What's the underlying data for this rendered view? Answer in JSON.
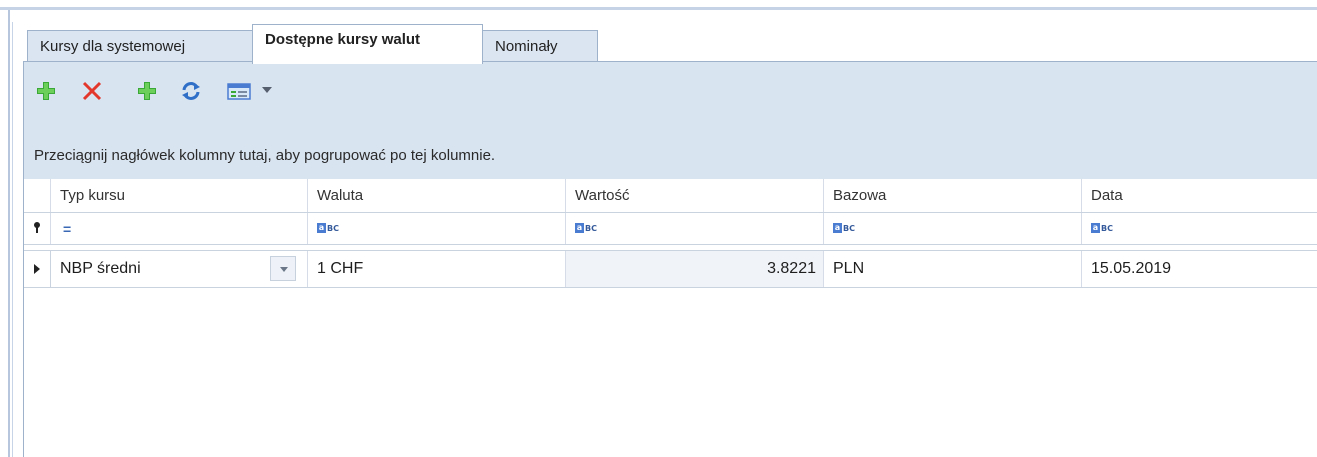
{
  "tabs": [
    {
      "label": "Kursy dla systemowej",
      "active": false
    },
    {
      "label": "Dostępne kursy walut",
      "active": true
    },
    {
      "label": "Nominały",
      "active": false
    }
  ],
  "toolbar": {
    "buttons": [
      {
        "icon": "add-icon",
        "color": "#3aa836"
      },
      {
        "icon": "delete-icon",
        "color": "#e3372b"
      },
      {
        "icon": "add-icon",
        "color": "#3aa836"
      },
      {
        "icon": "refresh-icon",
        "color": "#2f6fc7"
      },
      {
        "icon": "view-icon",
        "color": "#4a7dd1"
      },
      {
        "icon": "chevron-down-icon",
        "color": "#555f6e"
      }
    ]
  },
  "grid": {
    "group_hint": "Przeciągnij nagłówek kolumny tutaj, aby pogrupować po tej kolumnie.",
    "columns": [
      "Typ kursu",
      "Waluta",
      "Wartość",
      "Bazowa",
      "Data"
    ],
    "filter_row": {
      "typ_kursu": "=",
      "abc_label": "BC"
    },
    "rows": [
      {
        "typ_kursu": "NBP średni",
        "waluta": "1 CHF",
        "wartosc": "3.8221",
        "bazowa": "PLN",
        "data": "15.05.2019"
      }
    ]
  },
  "colors": {
    "toolbar_bg": "#d9e4f1",
    "tab_border": "#9fb2cc",
    "value_cell_bg": "#f0f3f8"
  }
}
